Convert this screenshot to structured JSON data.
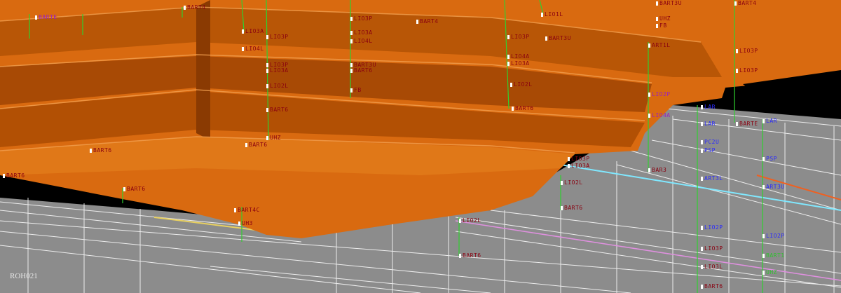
{
  "viewport": {
    "view_name": "ROH021"
  },
  "colors": {
    "pit_surface": "#d96a10",
    "pit_shadow": "#a84a05",
    "ground_plane": "#8c8c8c",
    "grid_lines": "#ffffff",
    "drillhole": "#30d030",
    "label_dark": "#8a0010",
    "label_blue": "#2a2aff"
  },
  "labels": [
    {
      "text": "BART4"
    },
    {
      "text": "LIO3A"
    },
    {
      "text": "LIO3P"
    },
    {
      "text": "LIO4L"
    },
    {
      "text": "BART3U"
    },
    {
      "text": "BART6"
    },
    {
      "text": "FB"
    },
    {
      "text": "LIO2L"
    },
    {
      "text": "UHZ"
    },
    {
      "text": "UH3"
    },
    {
      "text": "BART4C"
    },
    {
      "text": "LIO2P"
    },
    {
      "text": "LAR"
    },
    {
      "text": "ART3L"
    },
    {
      "text": "ART3U"
    },
    {
      "text": "BAR3"
    },
    {
      "text": "PSP"
    },
    {
      "text": "PC2U"
    },
    {
      "text": "LIO4A"
    },
    {
      "text": "ART1L"
    },
    {
      "text": "BART1"
    },
    {
      "text": "LIO1L"
    },
    {
      "text": "ART1U"
    },
    {
      "text": "UH1"
    },
    {
      "text": "BARTE"
    },
    {
      "text": "LIO3L"
    }
  ]
}
